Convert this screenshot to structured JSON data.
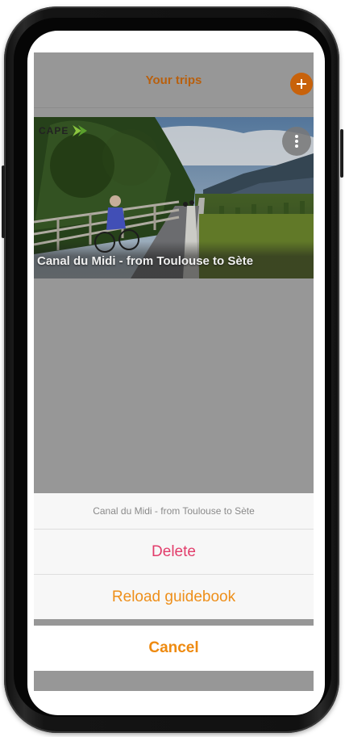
{
  "header": {
    "title": "Your trips",
    "add_icon": "plus-icon"
  },
  "trip": {
    "brand": "CAPE",
    "title": "Canal du Midi - from Toulouse to Sète",
    "more_icon": "more-vertical-icon"
  },
  "action_sheet": {
    "title": "Canal du Midi - from Toulouse to Sète",
    "delete_label": "Delete",
    "reload_label": "Reload guidebook",
    "cancel_label": "Cancel"
  },
  "colors": {
    "accent": "#ee8a10",
    "destructive": "#e23d6b",
    "overlay": "#979797"
  }
}
